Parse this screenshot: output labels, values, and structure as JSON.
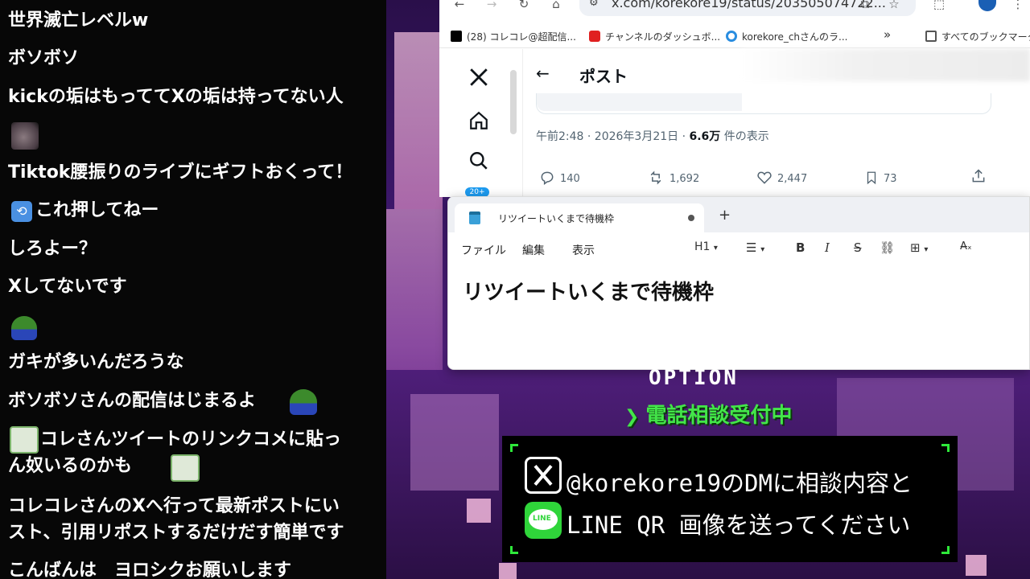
{
  "chat": {
    "messages": [
      "世界滅亡レベルw",
      "ボソボソ",
      "kickの垢はもっててXの垢は持ってない人",
      "Tiktok腰振りのライブにギフトおくって！",
      "これ押してねー",
      "しろよー？",
      "Xしてないです",
      "ガキが多いんだろうな",
      "ボソボソさんの配信はじまるよ",
      "コレさんツイートのリンクコメに貼っ",
      "ん奴いるのかも",
      "コレコレさんのXへ行って最新ポストにい",
      "スト、引用リポストするだけだす簡単です",
      "こんばんは　ヨロシクお願いします"
    ]
  },
  "browser": {
    "url": "x.com/korekore19/status/203505074722...",
    "bookmarks": [
      "(28) コレコレ@超配信...",
      "チャンネルのダッシュボ...",
      "korekore_chさんのラ...",
      "すべてのブックマーク"
    ],
    "overflow": "»"
  },
  "x_post": {
    "title": "ポスト",
    "back": "←",
    "badge": "20+",
    "meta_time": "午前2:48 · 2026年3月21日 · ",
    "meta_views": "6.6万",
    "meta_views_suffix": " 件の表示",
    "replies": "140",
    "reposts": "1,692",
    "likes": "2,447",
    "bookmarks": "73"
  },
  "notepad": {
    "tab_title": "リツイートいくまで待機枠",
    "new_tab": "+",
    "menu": [
      "ファイル",
      "編集",
      "表示"
    ],
    "heading_level": "H1",
    "tools": [
      "B",
      "I",
      "S"
    ],
    "content_heading": "リツイートいくまで待機枠"
  },
  "overlay": {
    "option": "OPTION",
    "consult": "電話相談受付中",
    "dm_line1": "@korekore19のDMに相談内容と",
    "dm_line2": "LINE QR 画像を送ってください",
    "line_logo_text": "LINE"
  },
  "colors": {
    "accent_green": "#43e649",
    "line_green": "#2fd53a"
  }
}
